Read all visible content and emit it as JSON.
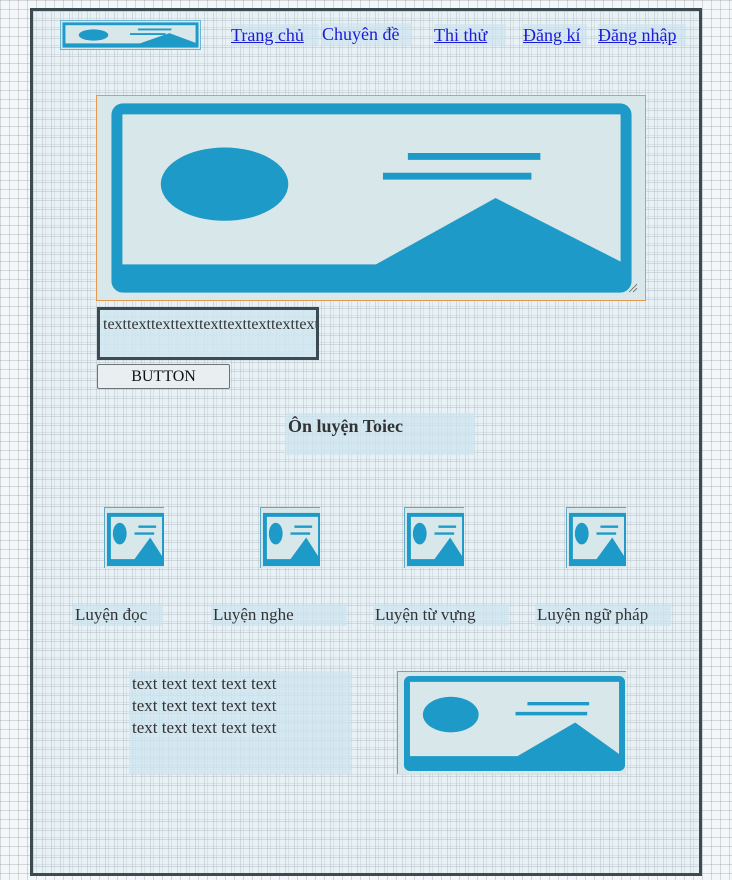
{
  "nav": {
    "items": [
      {
        "label": "Trang chủ"
      },
      {
        "label": "Chuyên đề"
      },
      {
        "label": "Thi thử"
      },
      {
        "label": "Đăng kí"
      },
      {
        "label": "Đăng nhập"
      }
    ]
  },
  "hero": {
    "textarea_value": "texttexttexttexttexttexttexttexttext",
    "button_label": "BUTTON"
  },
  "section": {
    "title": "Ôn luyện Toiec",
    "categories": [
      {
        "label": "Luyện đọc"
      },
      {
        "label": "Luyện nghe"
      },
      {
        "label": "Luyện từ vựng"
      },
      {
        "label": "Luyện ngữ pháp"
      }
    ]
  },
  "footer": {
    "lines": [
      "text text text text text",
      "text text text text text",
      "text text text text text"
    ]
  },
  "colors": {
    "placeholder_blue": "#1e9ac8",
    "placeholder_bg": "#d8e8ea",
    "link_blue": "#1a1ad8",
    "frame_border": "#3c4a52"
  }
}
